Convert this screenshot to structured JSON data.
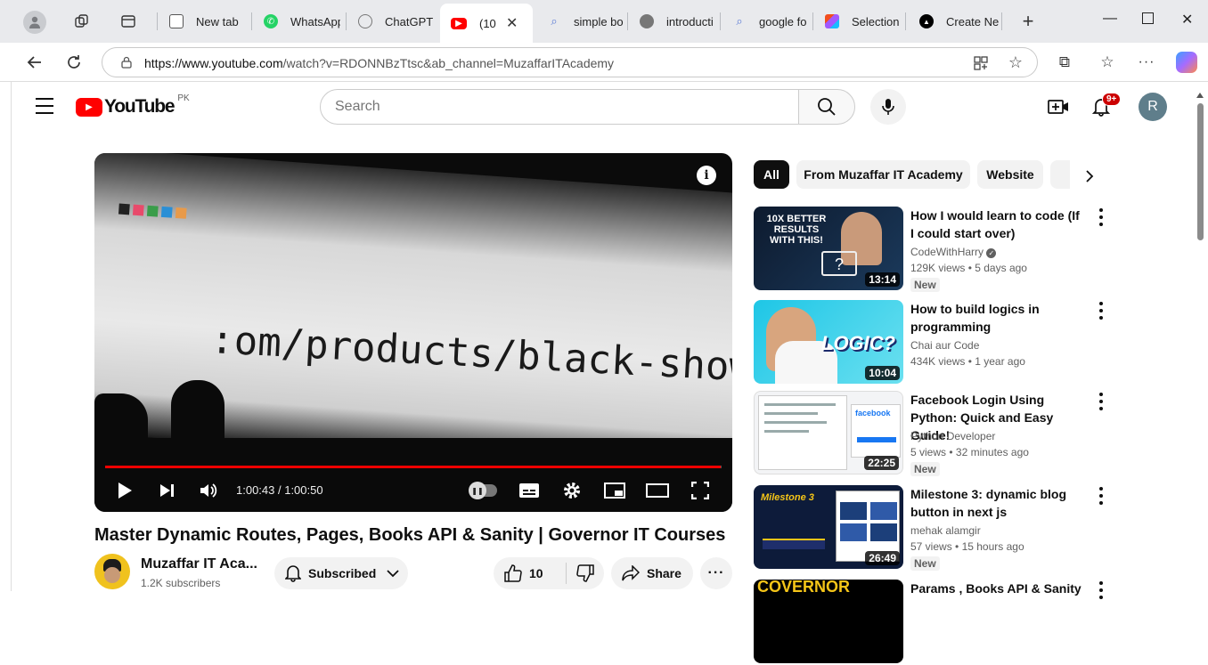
{
  "browser": {
    "tabs": [
      {
        "label": "New tab",
        "icon": "newtab-icon"
      },
      {
        "label": "WhatsApp",
        "icon": "whatsapp-icon"
      },
      {
        "label": "ChatGPT",
        "icon": "chatgpt-icon"
      },
      {
        "label": "(10",
        "icon": "youtube-icon",
        "active": true
      },
      {
        "label": "simple bo",
        "icon": "search-icon"
      },
      {
        "label": "introducti",
        "icon": "github-icon"
      },
      {
        "label": "google fo",
        "icon": "search-icon"
      },
      {
        "label": "Selection",
        "icon": "figma-icon"
      },
      {
        "label": "Create Ne",
        "icon": "vercel-icon"
      }
    ],
    "url_host": "https://www.youtube.com",
    "url_path": "/watch?v=RDONNBzTtsc&ab_channel=MuzaffarITAcademy"
  },
  "header": {
    "logo_text": "YouTube",
    "region": "PK",
    "search_placeholder": "Search",
    "notifications_badge": "9+",
    "avatar_letter": "R"
  },
  "player": {
    "overlay_text": ":om/products/black-show",
    "time_current": "1:00:43",
    "time_total": "1:00:50",
    "progress": 0.998
  },
  "video": {
    "title": "Master Dynamic Routes, Pages, Books API & Sanity | Governor IT Courses",
    "channel_name": "Muzaffar IT Aca...",
    "subscribers": "1.2K subscribers",
    "subscribe_label": "Subscribed",
    "likes": "10",
    "share_label": "Share"
  },
  "chips": [
    "All",
    "From Muzaffar IT Academy",
    "Website"
  ],
  "recommendations": [
    {
      "title": "How I would learn to code (If I could start over)",
      "channel": "CodeWithHarry",
      "verified": true,
      "views": "129K views",
      "age": "5 days ago",
      "duration": "13:14",
      "badge": "New",
      "thumb_text": "10X BETTER RESULTS WITH THIS!"
    },
    {
      "title": "How to build logics in programming",
      "channel": "Chai aur Code",
      "verified": false,
      "views": "434K views",
      "age": "1 year ago",
      "duration": "10:04",
      "badge": "",
      "thumb_text": "LOGIC?"
    },
    {
      "title": "Facebook Login Using Python: Quick and Easy Guide!",
      "channel": "Python Developer",
      "verified": false,
      "views": "5 views",
      "age": "32 minutes ago",
      "duration": "22:25",
      "badge": "New",
      "thumb_text": "facebook"
    },
    {
      "title": "Milestone 3: dynamic blog button in next js",
      "channel": "mehak alamgir",
      "verified": false,
      "views": "57 views",
      "age": "15 hours ago",
      "duration": "26:49",
      "badge": "New",
      "thumb_text": "Milestone 3"
    },
    {
      "title": "Params , Books API & Sanity",
      "channel": "",
      "verified": false,
      "views": "",
      "age": "",
      "duration": "",
      "badge": "",
      "thumb_text": "COVERNOR"
    }
  ],
  "colors": {
    "youtube_red": "#ff0000",
    "progress_red": "#ee0000",
    "chip_active_bg": "#0f0f0f"
  }
}
